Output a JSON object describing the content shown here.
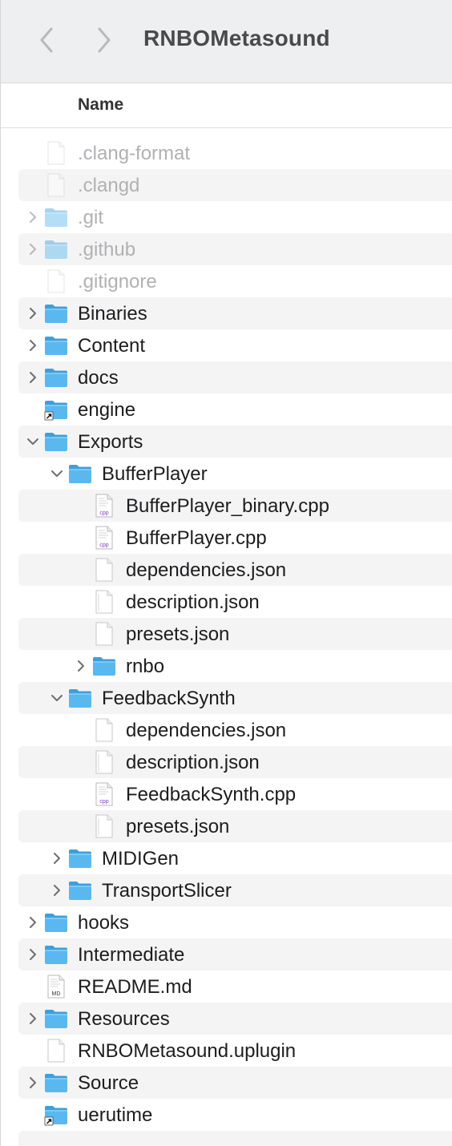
{
  "window": {
    "title": "RNBOMetasound",
    "back_icon": "chevron-left-icon",
    "forward_icon": "chevron-right-icon"
  },
  "columns": {
    "name": "Name"
  },
  "colors": {
    "folder": "#5ab8ef",
    "folder_dark": "#3e9fdc",
    "hidden_text": "#b1b1b4",
    "text": "#1d1d1f",
    "cpp_badge": "#7b3fbf"
  },
  "files": [
    {
      "label": ".clang-format",
      "kind": "file",
      "depth": 0,
      "hidden": true
    },
    {
      "label": ".clangd",
      "kind": "file",
      "depth": 0,
      "hidden": true
    },
    {
      "label": ".git",
      "kind": "folder",
      "depth": 0,
      "hidden": true,
      "expanded": false
    },
    {
      "label": ".github",
      "kind": "folder",
      "depth": 0,
      "hidden": true,
      "expanded": false
    },
    {
      "label": ".gitignore",
      "kind": "file",
      "depth": 0,
      "hidden": true
    },
    {
      "label": "Binaries",
      "kind": "folder",
      "depth": 0,
      "expanded": false
    },
    {
      "label": "Content",
      "kind": "folder",
      "depth": 0,
      "expanded": false
    },
    {
      "label": "docs",
      "kind": "folder",
      "depth": 0,
      "expanded": false
    },
    {
      "label": "engine",
      "kind": "folder-alias",
      "depth": 0
    },
    {
      "label": "Exports",
      "kind": "folder",
      "depth": 0,
      "expanded": true
    },
    {
      "label": "BufferPlayer",
      "kind": "folder",
      "depth": 1,
      "expanded": true
    },
    {
      "label": "BufferPlayer_binary.cpp",
      "kind": "cpp",
      "depth": 2
    },
    {
      "label": "BufferPlayer.cpp",
      "kind": "cpp",
      "depth": 2
    },
    {
      "label": "dependencies.json",
      "kind": "file",
      "depth": 2
    },
    {
      "label": "description.json",
      "kind": "file-lined",
      "depth": 2
    },
    {
      "label": "presets.json",
      "kind": "file",
      "depth": 2
    },
    {
      "label": "rnbo",
      "kind": "folder",
      "depth": 2,
      "expanded": false
    },
    {
      "label": "FeedbackSynth",
      "kind": "folder",
      "depth": 1,
      "expanded": true
    },
    {
      "label": "dependencies.json",
      "kind": "file",
      "depth": 2
    },
    {
      "label": "description.json",
      "kind": "file-lined",
      "depth": 2
    },
    {
      "label": "FeedbackSynth.cpp",
      "kind": "cpp",
      "depth": 2
    },
    {
      "label": "presets.json",
      "kind": "file-lined",
      "depth": 2
    },
    {
      "label": "MIDIGen",
      "kind": "folder",
      "depth": 1,
      "expanded": false
    },
    {
      "label": "TransportSlicer",
      "kind": "folder",
      "depth": 1,
      "expanded": false
    },
    {
      "label": "hooks",
      "kind": "folder",
      "depth": 0,
      "expanded": false
    },
    {
      "label": "Intermediate",
      "kind": "folder",
      "depth": 0,
      "expanded": false
    },
    {
      "label": "README.md",
      "kind": "md",
      "depth": 0
    },
    {
      "label": "Resources",
      "kind": "folder",
      "depth": 0,
      "expanded": false
    },
    {
      "label": "RNBOMetasound.uplugin",
      "kind": "file",
      "depth": 0
    },
    {
      "label": "Source",
      "kind": "folder",
      "depth": 0,
      "expanded": false
    },
    {
      "label": "uerutime",
      "kind": "folder-alias",
      "depth": 0
    },
    {
      "label": "",
      "kind": "empty",
      "depth": 0
    }
  ]
}
